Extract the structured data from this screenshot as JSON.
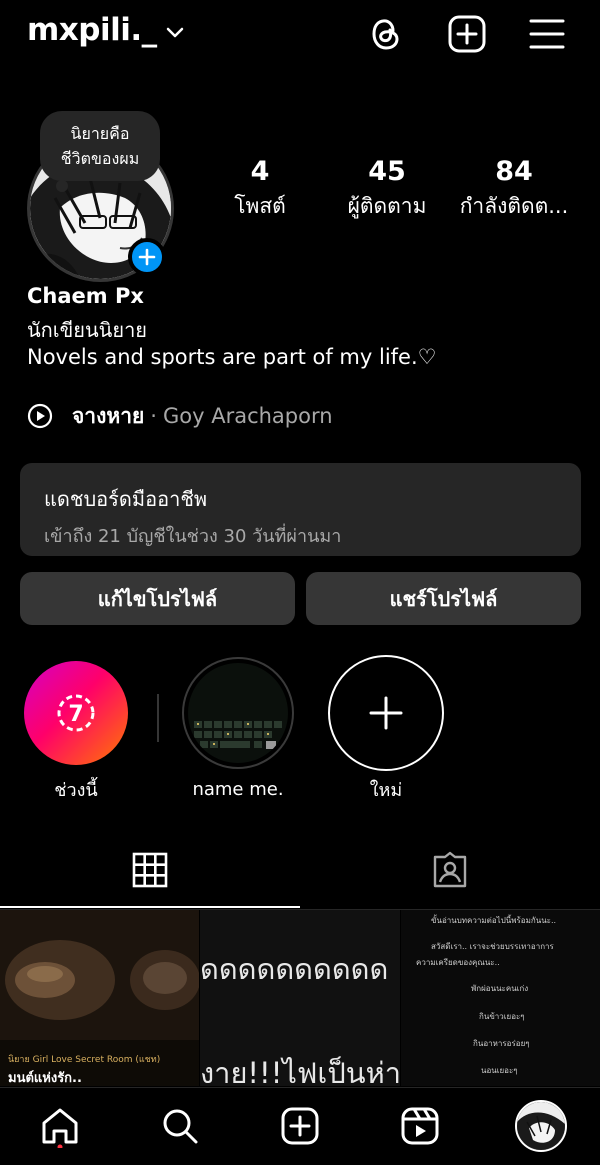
{
  "header": {
    "username": "mxpili._",
    "threads_icon": "threads-icon",
    "create_icon": "plus-square-icon",
    "menu_icon": "hamburger-icon"
  },
  "profile": {
    "note": "นิยายคือ\nชีวิตของผม",
    "note_line1": "นิยายคือ",
    "note_line2": "ชีวิตของผม",
    "stats": {
      "posts_num": "4",
      "posts_label": "โพสต์",
      "followers_num": "45",
      "followers_label": "ผู้ติดตาม",
      "following_num": "84",
      "following_label": "กำลังติดต..."
    },
    "display_name": "Chaem Px",
    "category": "นักเขียนนิยาย",
    "bio": "Novels and sports are part of my life.♡",
    "music_song": "จางหาย",
    "music_dot": "·",
    "music_artist": "Goy Arachaporn"
  },
  "dashboard": {
    "title": "แดชบอร์ดมืออาชีพ",
    "subtitle": "เข้าถึง 21 บัญชีในช่วง 30 วันที่ผ่านมา"
  },
  "buttons": {
    "edit": "แก้ไขโปรไฟล์",
    "share": "แชร์โปรไฟล์"
  },
  "highlights": [
    {
      "label": "ช่วงนี้",
      "badge": "7"
    },
    {
      "label": "name me."
    },
    {
      "label": "ใหม่"
    }
  ],
  "grid": {
    "post1_caption_small": "นิยาย Girl Love Secret Room (แชท)",
    "post1_caption": "มนต์แห่งรัก..",
    "post2_line1": "ดดดดดดดดดด",
    "post2_line2": "งาย!!!ไฟเป็นห่า",
    "post3_lines": [
      "ขั้นอ่านบทความต่อไปนี้พร้อมกันนะ..",
      "สวัสดีเรา.. เราจะช่วยบรรเทาอาการ",
      "ความเครียดของคุณนะ..",
      "พักผ่อนนะคนเก่ง",
      "กินข้าวเยอะๆ",
      "กินอาหารอร่อยๆ",
      "นอนเยอะๆ"
    ]
  },
  "colors": {
    "background": "#000000",
    "surface": "#262626",
    "button": "#363636",
    "accent_blue": "#0095f6",
    "muted_text": "#a8a8a8"
  }
}
